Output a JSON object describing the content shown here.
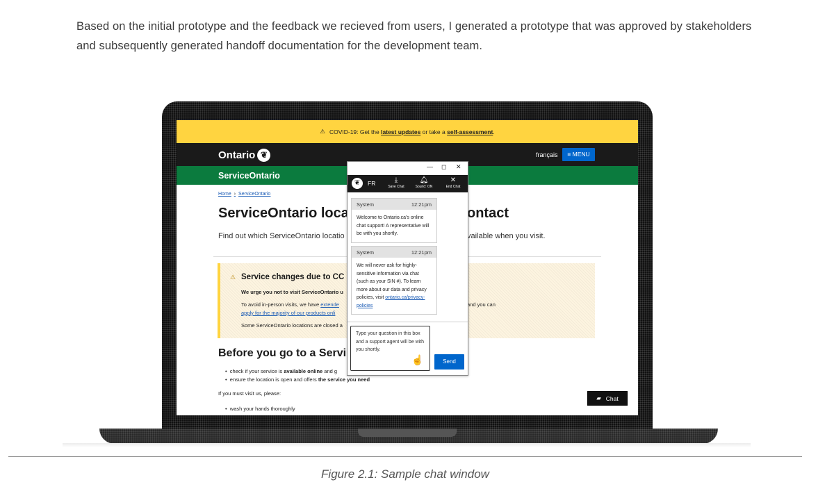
{
  "intro": {
    "paragraph": "Based on the initial prototype and the feedback we recieved from users, I generated a prototype that was approved by stakeholders and subsequently generated handoff documentation for the development team."
  },
  "caption": "Figure 2.1: Sample chat window",
  "site": {
    "covid": {
      "prefix": "COVID-19: Get the",
      "link1": "latest updates",
      "middle": "or take a",
      "link2": "self-assessment",
      "suffix": "."
    },
    "logo_text": "Ontario",
    "lang_link": "français",
    "menu_label": "≡ MENU",
    "banner_title": "ServiceOntario",
    "breadcrumb": {
      "home": "Home",
      "current": "ServiceOntario"
    },
    "page_title_left": "ServiceOntario loca",
    "page_title_right": "ontact",
    "subtitle_left": "Find out which ServiceOntario locatio",
    "subtitle_right": "vailable when you visit.",
    "alert": {
      "title": "Service changes due to CC",
      "line1": "We urge you not to visit ServiceOntario u",
      "line2_prefix": "To avoid in-person visits, we have",
      "line2_link": "extende",
      "line2_right": "and you can",
      "line3": "apply for the majority of our products onli",
      "line4": "Some ServiceOntario locations are closed a"
    },
    "section_title": "Before you go to a Servi",
    "bullet1_prefix": "check if your service is",
    "bullet1_bold": "available online",
    "bullet1_suffix": "and g",
    "bullet2_prefix": "ensure the location is open and offers",
    "bullet2_bold": "the service you need",
    "if_must": "If you must visit us, please:",
    "bullet3": "wash your hands thoroughly",
    "chat_button": "Chat"
  },
  "chat": {
    "window_controls": [
      "—",
      "◻",
      "✕"
    ],
    "lang_toggle": "FR",
    "actions": [
      {
        "icon": "save-icon",
        "label": "Save Chat"
      },
      {
        "icon": "bell-icon",
        "label": "Sound: ON"
      },
      {
        "icon": "close-icon",
        "label": "End Chat"
      }
    ],
    "messages": [
      {
        "sender": "System",
        "time": "12:21pm",
        "text": "Welcome to Ontario.ca's online chat support! A representative will be with you shortly."
      },
      {
        "sender": "System",
        "time": "12:21pm",
        "text": "We will never ask for highly-sensitive information via chat (such as your SIN #). To learn more about our data and privacy policies, visit",
        "link": "ontario.ca/privacy-policies"
      }
    ],
    "input_placeholder": "Type your question in this box and a support agent will be with you shortly.",
    "send_label": "Send"
  }
}
